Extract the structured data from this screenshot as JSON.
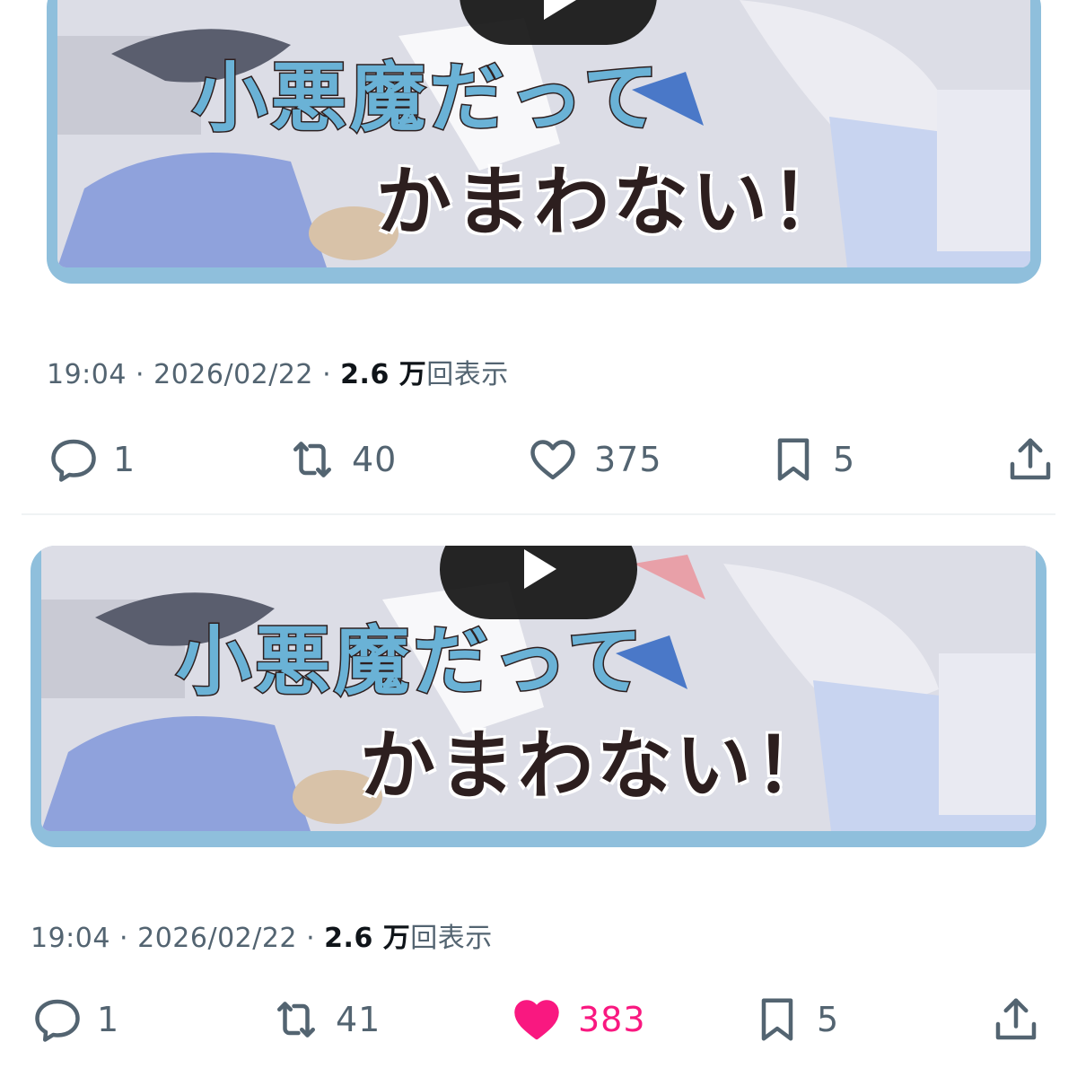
{
  "posts": [
    {
      "media": {
        "title_line1": "小悪魔だって",
        "title_line2": "かまわない！",
        "play_label": "play"
      },
      "meta": {
        "time": "19:04",
        "date": "2026/02/22",
        "views_count": "2.6 万",
        "views_label": "回表示",
        "separator": "·"
      },
      "actions": {
        "reply_count": "1",
        "repost_count": "40",
        "like_count": "375",
        "bookmark_count": "5",
        "liked": false
      }
    },
    {
      "media": {
        "title_line1": "小悪魔だって",
        "title_line2": "かまわない！",
        "play_label": "play"
      },
      "meta": {
        "time": "19:04",
        "date": "2026/02/22",
        "views_count": "2.6 万",
        "views_label": "回表示",
        "separator": "·"
      },
      "actions": {
        "reply_count": "1",
        "repost_count": "41",
        "like_count": "383",
        "bookmark_count": "5",
        "liked": true
      }
    }
  ],
  "colors": {
    "secondary_text": "#536471",
    "primary_text": "#0f1419",
    "like_pink": "#f91880",
    "media_frame": "#8fbfdc"
  },
  "icons": [
    "reply-icon",
    "repost-icon",
    "heart-icon",
    "bookmark-icon",
    "share-icon",
    "play-icon"
  ]
}
